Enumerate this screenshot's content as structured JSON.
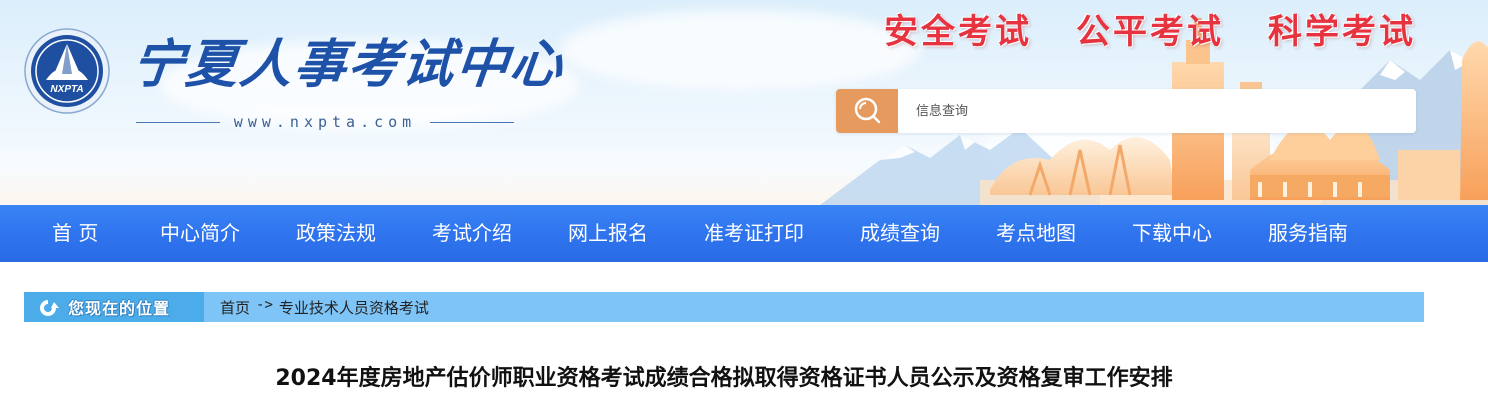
{
  "header": {
    "site_title": "宁夏人事考试中心",
    "site_url": "www.nxpta.com",
    "emblem_text": "NXPTA",
    "slogans": [
      "安全考试",
      "公平考试",
      "科学考试"
    ],
    "search": {
      "placeholder": "信息查询",
      "icon": "search-icon"
    },
    "colors": {
      "slogan": "#e6333f",
      "title": "#1d52a8",
      "search_button": "#e69a5e"
    }
  },
  "nav": {
    "items": [
      {
        "label": "首 页"
      },
      {
        "label": "中心简介"
      },
      {
        "label": "政策法规"
      },
      {
        "label": "考试介绍"
      },
      {
        "label": "网上报名"
      },
      {
        "label": "准考证打印"
      },
      {
        "label": "成绩查询"
      },
      {
        "label": "考点地图"
      },
      {
        "label": "下载中心"
      },
      {
        "label": "服务指南"
      }
    ],
    "background": "#2f74ee"
  },
  "breadcrumb": {
    "label": "您现在的位置",
    "items": [
      "首页",
      "专业技术人员资格考试"
    ],
    "separator": "->"
  },
  "article": {
    "title": "2024年度房地产估价师职业资格考试成绩合格拟取得资格证书人员公示及资格复审工作安排"
  }
}
